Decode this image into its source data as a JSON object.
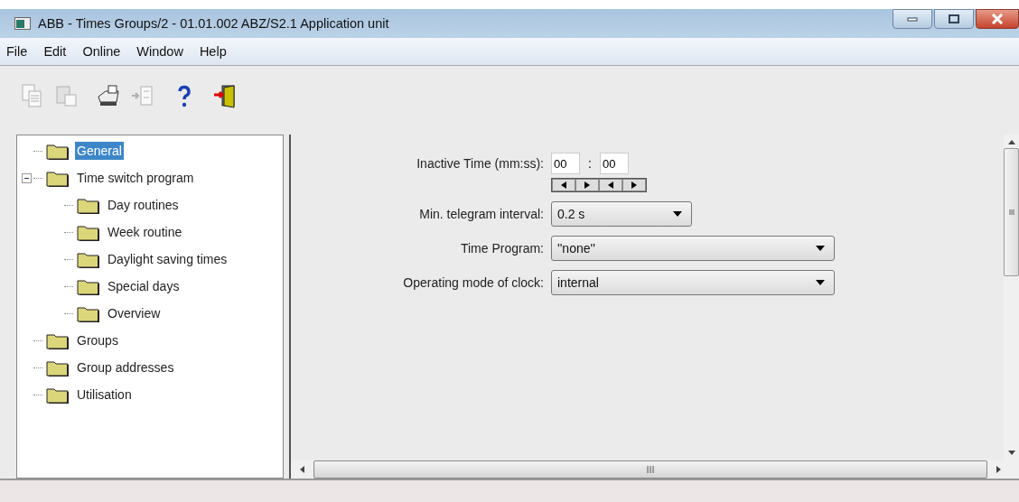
{
  "window": {
    "title": "ABB - Times Groups/2 - 01.01.002 ABZ/S2.1 Application unit"
  },
  "menu": [
    "File",
    "Edit",
    "Online",
    "Window",
    "Help"
  ],
  "toolbar": [
    {
      "kind": "copy",
      "disabled": true
    },
    {
      "kind": "paste",
      "disabled": true
    },
    {
      "kind": "print",
      "disabled": false
    },
    {
      "kind": "import",
      "disabled": true
    },
    {
      "kind": "help",
      "disabled": false
    },
    {
      "kind": "exit",
      "disabled": false
    }
  ],
  "tree": [
    {
      "label": "General",
      "selected": true
    },
    {
      "label": "Time switch program",
      "selected": false,
      "expanded": true,
      "children": [
        {
          "label": "Day routines",
          "selected": false
        },
        {
          "label": "Week routine",
          "selected": false
        },
        {
          "label": "Daylight saving times",
          "selected": false
        },
        {
          "label": "Special days",
          "selected": false
        },
        {
          "label": "Overview",
          "selected": false
        }
      ]
    },
    {
      "label": "Groups",
      "selected": false
    },
    {
      "label": "Group addresses",
      "selected": false
    },
    {
      "label": "Utilisation",
      "selected": false
    }
  ],
  "form": [
    {
      "kind": "time",
      "label": "Inactive Time (mm:ss):",
      "minutes": "00",
      "separator": ":",
      "seconds": "00"
    },
    {
      "kind": "compact",
      "label": "Min. telegram interval:",
      "value": "0.2 s"
    },
    {
      "kind": "select",
      "label": "Time Program:",
      "value": "''none''"
    },
    {
      "kind": "select",
      "label": "Operating mode of clock:",
      "value": "internal"
    }
  ]
}
